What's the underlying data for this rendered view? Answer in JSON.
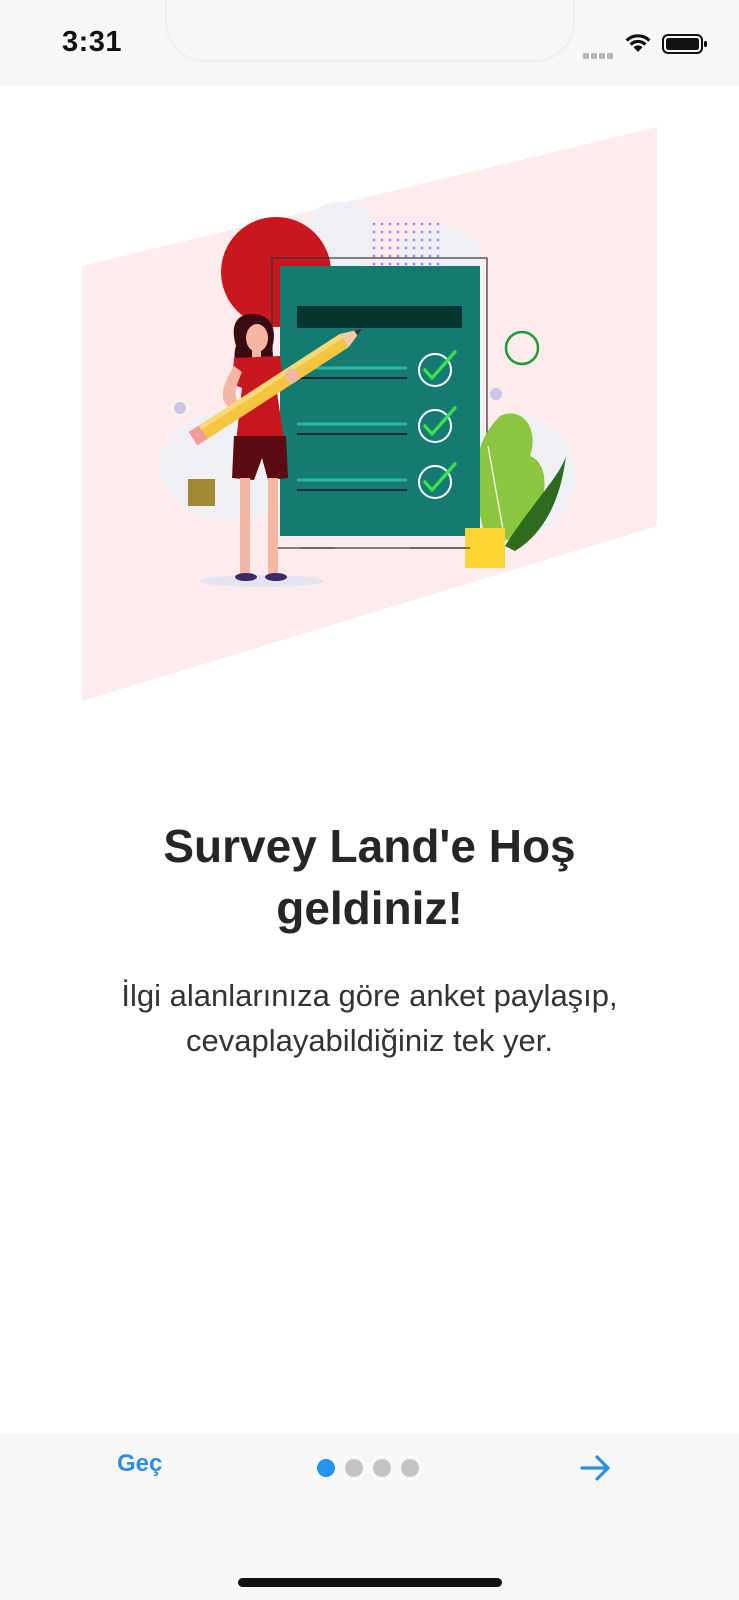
{
  "status_bar": {
    "time": "3:31",
    "icons": [
      "signal-icon",
      "wifi-icon",
      "battery-icon"
    ]
  },
  "illustration": {
    "name": "survey-checklist-illustration"
  },
  "onboarding": {
    "title_line1": "Survey Land'e Hoş",
    "title_line2": "geldiniz!",
    "subtitle_line1": "İlgi alanlarınıza göre anket paylaşıp,",
    "subtitle_line2": "cevaplayabildiğiniz tek yer.",
    "page_count": 4,
    "active_page": 1
  },
  "footer": {
    "skip_label": "Geç",
    "next_icon": "arrow-right-icon"
  },
  "colors": {
    "accent": "#2196f3",
    "skip_text": "#2d8fe0",
    "board": "#147a72",
    "pink_bg": "#fdeceb",
    "red_circle": "#c8171e"
  }
}
